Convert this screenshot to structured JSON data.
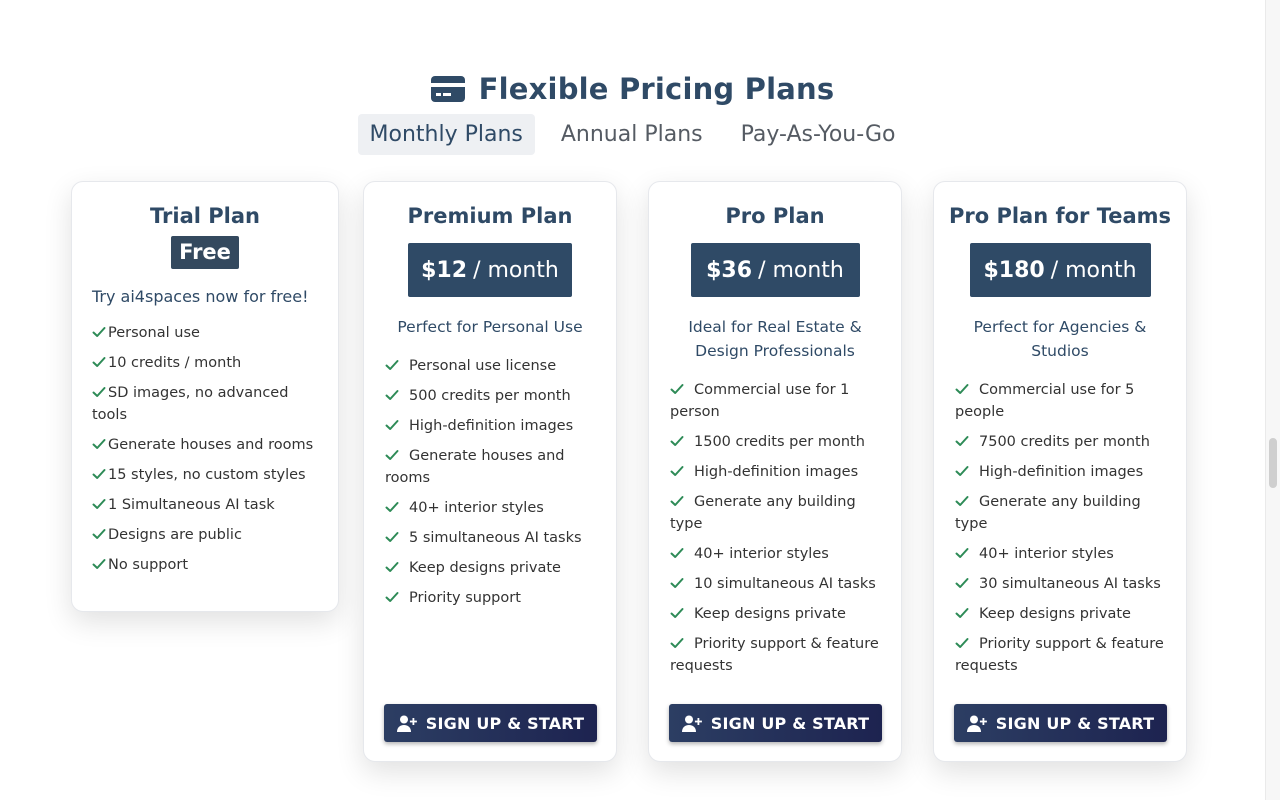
{
  "header": {
    "title": "Flexible Pricing Plans",
    "icon": "credit-card-icon"
  },
  "tabs": [
    {
      "label": "Monthly Plans",
      "active": true
    },
    {
      "label": "Annual Plans",
      "active": false
    },
    {
      "label": "Pay-As-You-Go",
      "active": false
    }
  ],
  "plans": {
    "trial": {
      "name": "Trial Plan",
      "price": "Free",
      "tagline": "Try ai4spaces now for free!",
      "features": [
        "Personal use",
        "10 credits / month",
        "SD images, no advanced tools",
        "Generate houses and rooms",
        "15 styles, no custom styles",
        "1 Simultaneous AI task",
        "Designs are public",
        "No support"
      ]
    },
    "premium": {
      "name": "Premium Plan",
      "price_amount": "$12",
      "price_period": "/ month",
      "tagline": "Perfect for Personal Use",
      "features": [
        "Personal use license",
        "500 credits per month",
        "High-definition images",
        "Generate houses and rooms",
        "40+ interior styles",
        "5 simultaneous AI tasks",
        "Keep designs private",
        "Priority support"
      ],
      "button": "SIGN UP & START"
    },
    "pro": {
      "name": "Pro Plan",
      "price_amount": "$36",
      "price_period": "/ month",
      "tagline": "Ideal for Real Estate & Design Professionals",
      "features": [
        "Commercial use for 1 person",
        "1500 credits per month",
        "High-definition images",
        "Generate any building type",
        "40+ interior styles",
        "10 simultaneous AI tasks",
        "Keep designs private",
        "Priority support & feature requests"
      ],
      "button": "SIGN UP & START"
    },
    "teams": {
      "name": "Pro Plan for Teams",
      "price_amount": "$180",
      "price_period": "/ month",
      "tagline": "Perfect for Agencies & Studios",
      "features": [
        "Commercial use for 5 people",
        "7500 credits per month",
        "High-definition images",
        "Generate any building type",
        "40+ interior styles",
        "30 simultaneous AI tasks",
        "Keep designs private",
        "Priority support & feature requests"
      ],
      "button": "SIGN UP & START"
    }
  },
  "colors": {
    "accent": "#2f4a66",
    "check": "#2e8b57",
    "button_start": "#2c3e63",
    "button_end": "#1d2350"
  }
}
